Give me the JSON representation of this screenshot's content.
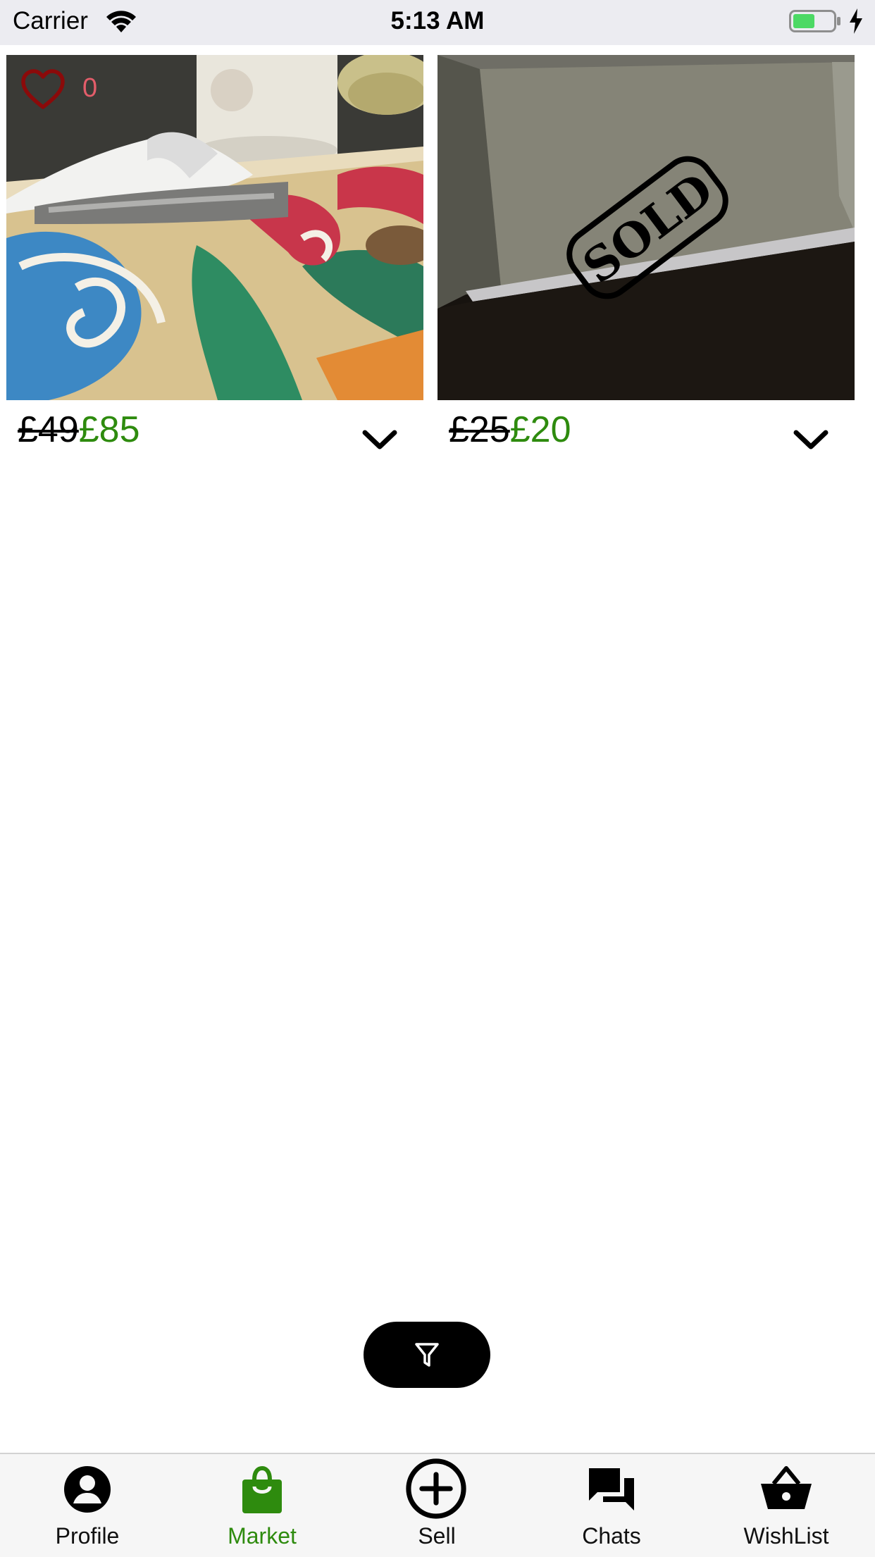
{
  "status_bar": {
    "carrier": "Carrier",
    "time": "5:13 AM",
    "battery_color": "#4cd964"
  },
  "products": [
    {
      "likes": "0",
      "old_price": "£49",
      "new_price": "£85",
      "photo": "tissue-box-photo"
    },
    {
      "sold_stamp": "SOLD",
      "old_price": "£25",
      "new_price": "£20",
      "photo": "dark-item-photo"
    }
  ],
  "filter": {
    "icon": "filter-icon"
  },
  "tabs": [
    {
      "label": "Profile",
      "icon": "profile-icon",
      "active": false
    },
    {
      "label": "Market",
      "icon": "shopping-bag-icon",
      "active": true
    },
    {
      "label": "Sell",
      "icon": "add-circle-icon",
      "active": false
    },
    {
      "label": "Chats",
      "icon": "chat-bubbles-icon",
      "active": false
    },
    {
      "label": "WishList",
      "icon": "basket-icon",
      "active": false
    }
  ],
  "colors": {
    "accent_green": "#2e8b0e",
    "like_red": "#8b0a0a",
    "like_count": "#e35d6a"
  }
}
